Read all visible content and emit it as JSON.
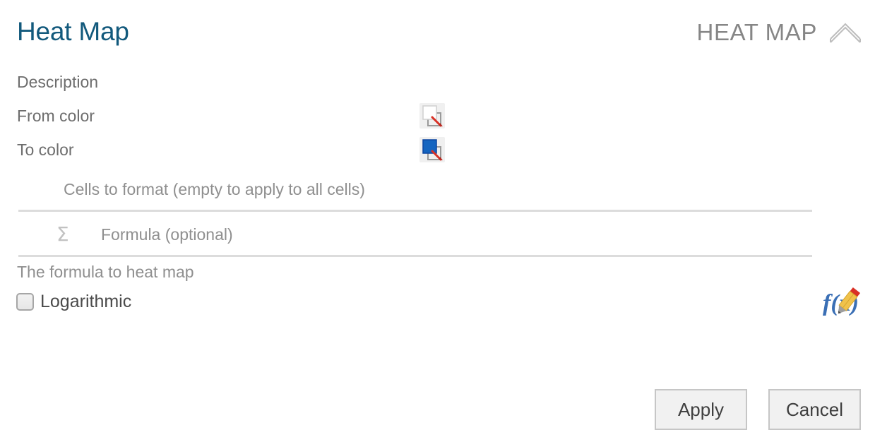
{
  "header": {
    "title": "Heat Map",
    "kicker": "HEAT MAP",
    "collapse_icon": "chevron-up-icon"
  },
  "form": {
    "description_label": "Description",
    "from_color_label": "From color",
    "to_color_label": "To color",
    "from_color_icon": "color-picker-icon",
    "from_color_value": "#ffffff",
    "to_color_icon": "color-picker-icon",
    "to_color_value": "#1565c0",
    "cells_placeholder": "Cells to format (empty to apply to all cells)",
    "cells_value": "",
    "formula_sigma_icon": "sigma-icon",
    "formula_placeholder": "Formula (optional)",
    "formula_value": "",
    "formula_helper": "The formula to heat map",
    "logarithmic_label": "Logarithmic",
    "logarithmic_checked": "false",
    "formula_editor_icon": "fx-pencil-icon"
  },
  "footer": {
    "apply_label": "Apply",
    "cancel_label": "Cancel"
  },
  "colors": {
    "title": "#12597c",
    "kicker": "#868686",
    "label": "#6d6d6d",
    "placeholder": "#8f8f8f",
    "divider": "#dcdcdc",
    "button_face": "#f1f1f1",
    "button_border": "#c6c6c6",
    "swatch_to": "#1565c0",
    "swatch_from": "#ffffff",
    "pencil_red": "#d93025",
    "fx_blue": "#3a6fb5",
    "pencil_yellow": "#f0c24b"
  }
}
